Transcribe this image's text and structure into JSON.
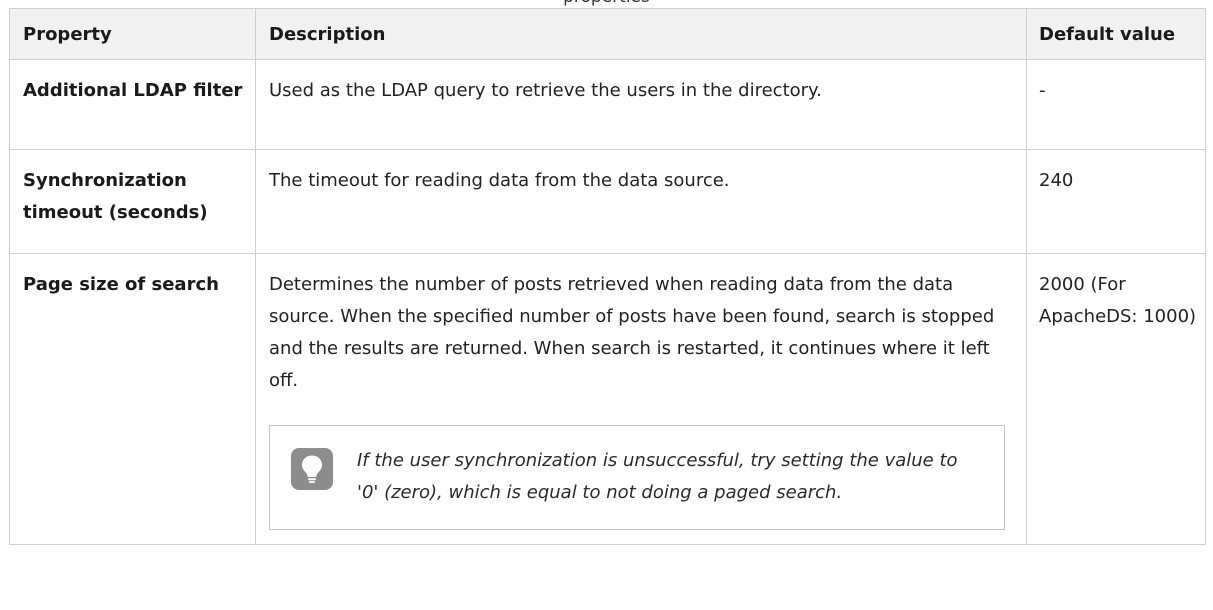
{
  "caption": "properties",
  "table": {
    "headers": {
      "property": "Property",
      "description": "Description",
      "default_value": "Default value"
    },
    "rows": [
      {
        "property": "Additional LDAP filter",
        "description": "Used as the LDAP query to retrieve the users in the directory.",
        "default_value": "-"
      },
      {
        "property": "Synchronization timeout (seconds)",
        "description": "The timeout for reading data from the data source.",
        "default_value": "240"
      },
      {
        "property": "Page size of search",
        "description": "Determines the number of posts retrieved when reading data from the data source. When the specified number of posts have been found, search is stopped and the results are returned. When search is restarted, it continues where it left off.",
        "default_value": "2000 (For ApacheDS: 1000)",
        "tip": {
          "icon": "lightbulb-icon",
          "text": "If the user synchronization is unsuccessful, try setting the value to '0' (zero), which is equal to not doing a paged search."
        }
      }
    ]
  },
  "colors": {
    "header_background": "#f1f1f1",
    "border": "#cfcfcf",
    "tip_icon": "#8d8d8d"
  }
}
